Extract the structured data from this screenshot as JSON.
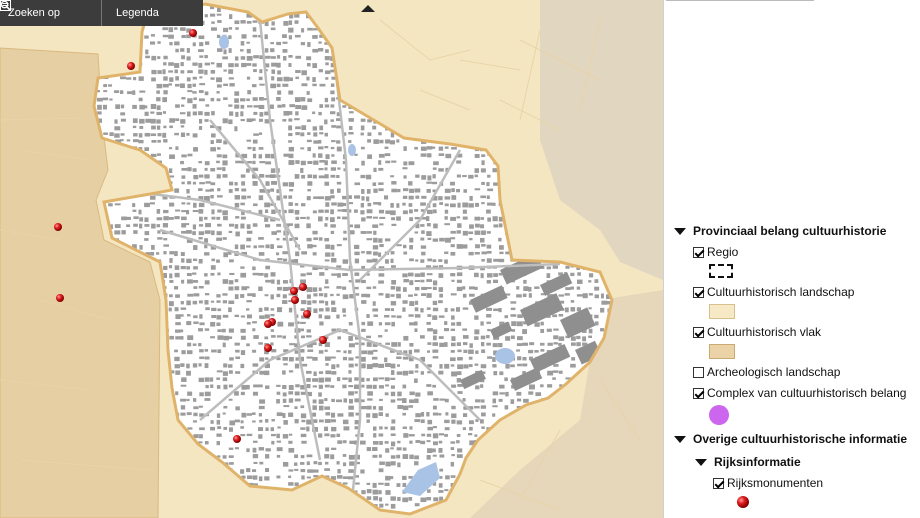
{
  "toolbar": {
    "search_label": "Zoeken op",
    "legend_label": "Legenda"
  },
  "legend": {
    "section_provincial": "Provinciaal belang cultuurhistorie",
    "items": [
      {
        "label": "Regio",
        "checked": true
      },
      {
        "label": "Cultuurhistorisch landschap",
        "checked": true
      },
      {
        "label": "Cultuurhistorisch vlak",
        "checked": true
      },
      {
        "label": "Archeologisch landschap",
        "checked": false
      },
      {
        "label": "Complex van cultuurhistorisch belang",
        "checked": true
      }
    ],
    "section_other": "Overige cultuurhistorische informatie",
    "subsection_rijks": "Rijksinformatie",
    "rijks_item": {
      "label": "Rijksmonumenten",
      "checked": true
    }
  },
  "colors": {
    "landscape": "#f7e9c6",
    "vlak": "#ecd3a7",
    "complex": "#cc66ee",
    "monument": "#d11a1a",
    "boundary": "#e0b36a"
  }
}
